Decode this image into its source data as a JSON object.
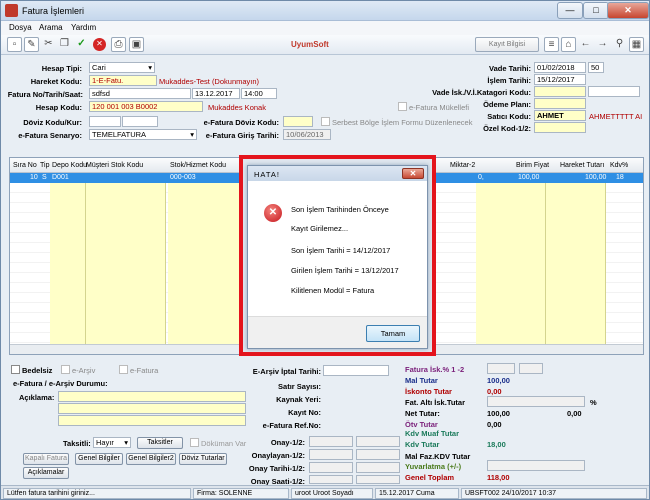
{
  "window": {
    "title": "Fatura İşlemleri",
    "min": "—",
    "max": "□",
    "close": "✕"
  },
  "menu": [
    "Dosya",
    "Arama",
    "Yardım"
  ],
  "toolbar": {
    "brand": "UyumSoft",
    "kayit_bilgisi": "Kayıt Bilgisi"
  },
  "form": {
    "hesap_tipi_label": "Hesap Tipi:",
    "hesap_tipi": "Cari",
    "hareket_kodu_label": "Hareket Kodu:",
    "hareket_kodu": "1-E-Fatu.",
    "hareket_desc": "Mukaddes-Test (Dokunmayın)",
    "fatura_no_label": "Fatura No/Tarih/Saat:",
    "fatura_no": "sdfsd",
    "fatura_tarih": "13.12.2017",
    "fatura_saat": "14:00",
    "hesap_kodu_label": "Hesap Kodu:",
    "hesap_kodu": "120 001 003 B0002",
    "hesap_desc": "Mukaddes Konak",
    "doviz_kodu_label": "Döviz Kodu/Kur:",
    "senaryo_label": "e-Fatura Senaryo:",
    "senaryo": "TEMELFATURA",
    "efatura_mukellefi": "e-Fatura Mükellefi",
    "efatura_doviz_label": "e-Fatura Döviz Kodu:",
    "serbest_bolge": "Serbest Bölge İşlem Formu Düzenlenecek",
    "efatura_giris_label": "e-Fatura Giriş Tarihi:",
    "efatura_giris": "10/06/2013",
    "vade_tarihi_label": "Vade Tarihi:",
    "vade_tarihi": "01/02/2018",
    "vade_gun": "50",
    "islem_tarihi_label": "İşlem Tarihi:",
    "islem_tarihi": "15/12/2017",
    "vade_isk_label": "Vade İsk./V.İ.Katagori Kodu:",
    "odeme_plani_label": "Ödeme Planı:",
    "satici_kodu_label": "Satıcı Kodu:",
    "satici_kodu": "AHMET",
    "satici_desc": "AHMETTTTT AI",
    "ozel_kod_label": "Özel Kod-1/2:"
  },
  "grid": {
    "headers": [
      "Sıra No",
      "Tip",
      "Depo Kodu",
      "Müşteri Stok Kodu",
      "Stok/Hizmet Kodu",
      "Miktar-2",
      "Birim Fiyat",
      "Hareket Tutarı",
      "Kdv%"
    ],
    "row": {
      "sira": "10",
      "tip": "S",
      "depo": "D001",
      "stok": "000-003",
      "miktar2": "0,",
      "birim_fiyat": "100,00",
      "hareket_tutari": "100,00",
      "kdv": "18"
    }
  },
  "bottom": {
    "bedelsiz": "Bedelsiz",
    "earsiv": "e-Arşiv",
    "efatura": "e-Fatura",
    "durum_label": "e-Fatura / e-Arşiv Durumu:",
    "aciklama_label": "Açıklama:",
    "iptal_label": "E-Arşiv İptal Tarihi:",
    "satir_label": "Satır Sayısı:",
    "kaynak_label": "Kaynak Yeri:",
    "kayit_label": "Kayıt No:",
    "ref_label": "e-Fatura Ref.No:",
    "taksitler_label": "Taksitli:",
    "taksitli": "Hayır",
    "taksitler_btn": "Taksitler",
    "dokuman_var": "Döküman Var",
    "kapali_fatura": "Kapalı Fatura",
    "genel_bilgiler": "Genel Bilgiler",
    "genel_bilgiler2": "Genel Bilgiler2",
    "doviz_tutarlar": "Döviz Tutarlar",
    "aciklamalar": "Açıklamalar",
    "onay1": "Onay-1/2:",
    "onaylayan": "Onaylayan-1/2:",
    "onay_tarihi": "Onay Tarihi-1/2:",
    "onay_saati": "Onay Saati-1/2:"
  },
  "summary": {
    "fatura_isk_label": "Fatura İsk.% 1 -2",
    "mal_tutar_label": "Mal Tutar",
    "mal_tutar": "100,00",
    "iskonto_label": "İskonto Tutar",
    "iskonto": "0,00",
    "fat_alti_label": "Fat. Altı İsk.Tutar",
    "fat_alti_pct": "%",
    "net_tutar_label": "Net Tutar:",
    "net_tutar": "100,00",
    "net_tutar2": "0,00",
    "otv_label": "Ötv Tutar",
    "otv": "0,00",
    "kdv_muaf_label": "Kdv Muaf Tutar",
    "kdv_tutar_label": "Kdv Tutar",
    "kdv_tutar": "18,00",
    "mal_faz_label": "Mal Faz.KDV Tutar",
    "yuvarlatma_label": "Yuvarlatma (+/-)",
    "genel_toplam_label": "Genel Toplam",
    "genel_toplam": "118,00"
  },
  "status": {
    "msg": "Lütfen fatura tarihini giriniz...",
    "firma": "Firma: SOLENNE",
    "user": "uroot Uroot Soyadı",
    "date": "15.12.2017 Cuma",
    "build": "UBSFT002 24/10/2017 10:37"
  },
  "dialog": {
    "title": "HATA!",
    "line1": "Son İşlem Tarihinden Önceye",
    "line2": "Kayıt Girilemez...",
    "line3": "Son İşlem Tarihi = 14/12/2017",
    "line4": "Girilen İşlem Tarihi = 13/12/2017",
    "line5": "Kilitlenen Modül = Fatura",
    "ok": "Tamam",
    "close": "✕"
  },
  "colors": {
    "error_border": "#e4141c",
    "selected_row": "#2f8fe4",
    "required_field": "#ffffc8"
  }
}
